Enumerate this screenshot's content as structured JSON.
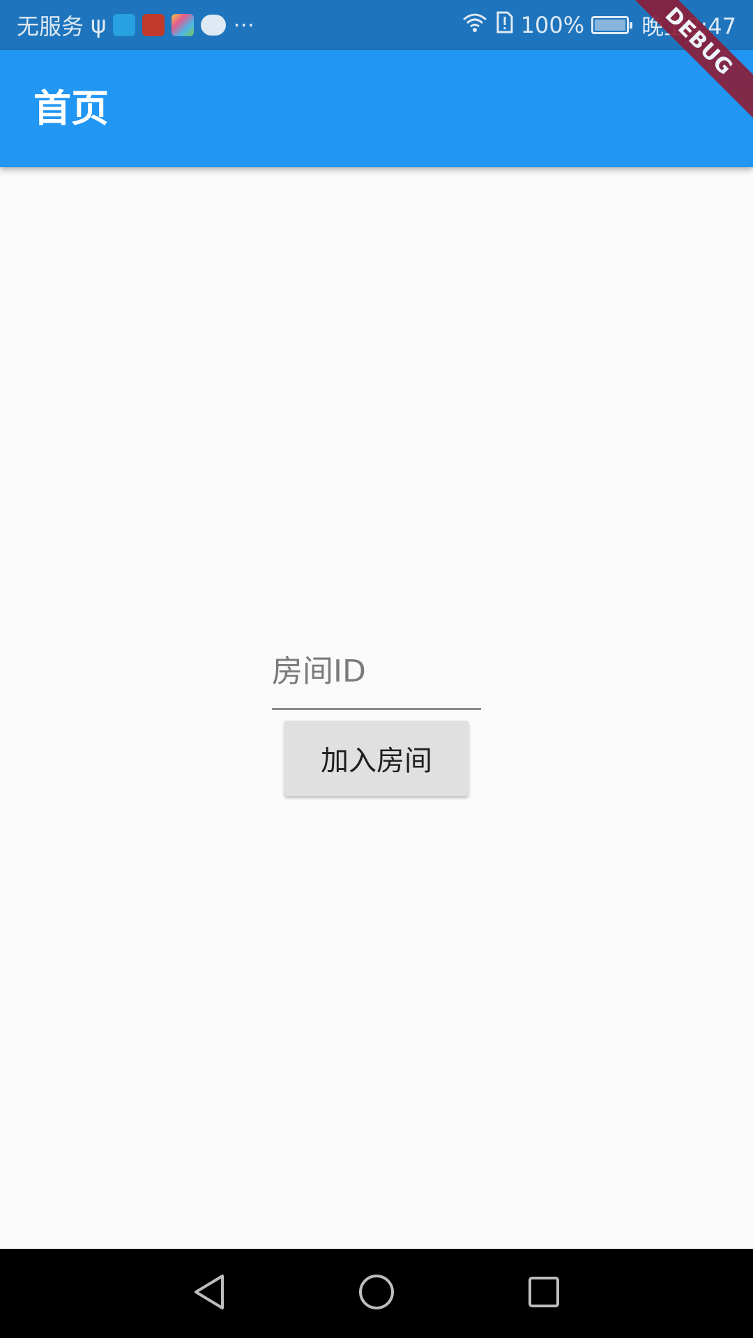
{
  "status_bar": {
    "carrier": "无服务",
    "usb_symbol": "ψ",
    "more": "···",
    "battery_percent": "100%",
    "time": "晚上8:47",
    "icons": [
      "usb-icon",
      "video-app-icon",
      "huawei-app-icon",
      "photos-app-icon",
      "wechat-icon",
      "wifi-icon",
      "sim-alert-icon",
      "battery-charging-icon"
    ]
  },
  "app_bar": {
    "title": "首页",
    "color": "#2196f3"
  },
  "debug_banner": "DEBUG",
  "form": {
    "room_id_placeholder": "房间ID",
    "room_id_value": "",
    "join_button_label": "加入房间"
  },
  "nav_bar": {
    "items": [
      "back-icon",
      "home-icon",
      "recents-icon"
    ]
  }
}
